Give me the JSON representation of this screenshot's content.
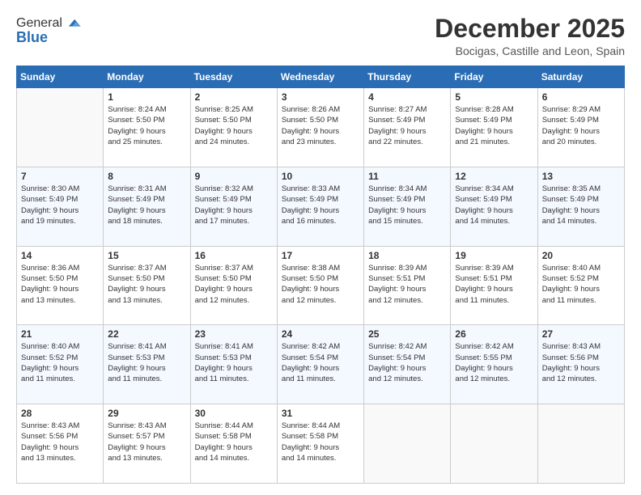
{
  "header": {
    "logo_line1": "General",
    "logo_line2": "Blue",
    "month_title": "December 2025",
    "location": "Bocigas, Castille and Leon, Spain"
  },
  "days_of_week": [
    "Sunday",
    "Monday",
    "Tuesday",
    "Wednesday",
    "Thursday",
    "Friday",
    "Saturday"
  ],
  "weeks": [
    [
      {
        "day": "",
        "info": ""
      },
      {
        "day": "1",
        "info": "Sunrise: 8:24 AM\nSunset: 5:50 PM\nDaylight: 9 hours\nand 25 minutes."
      },
      {
        "day": "2",
        "info": "Sunrise: 8:25 AM\nSunset: 5:50 PM\nDaylight: 9 hours\nand 24 minutes."
      },
      {
        "day": "3",
        "info": "Sunrise: 8:26 AM\nSunset: 5:50 PM\nDaylight: 9 hours\nand 23 minutes."
      },
      {
        "day": "4",
        "info": "Sunrise: 8:27 AM\nSunset: 5:49 PM\nDaylight: 9 hours\nand 22 minutes."
      },
      {
        "day": "5",
        "info": "Sunrise: 8:28 AM\nSunset: 5:49 PM\nDaylight: 9 hours\nand 21 minutes."
      },
      {
        "day": "6",
        "info": "Sunrise: 8:29 AM\nSunset: 5:49 PM\nDaylight: 9 hours\nand 20 minutes."
      }
    ],
    [
      {
        "day": "7",
        "info": "Sunrise: 8:30 AM\nSunset: 5:49 PM\nDaylight: 9 hours\nand 19 minutes."
      },
      {
        "day": "8",
        "info": "Sunrise: 8:31 AM\nSunset: 5:49 PM\nDaylight: 9 hours\nand 18 minutes."
      },
      {
        "day": "9",
        "info": "Sunrise: 8:32 AM\nSunset: 5:49 PM\nDaylight: 9 hours\nand 17 minutes."
      },
      {
        "day": "10",
        "info": "Sunrise: 8:33 AM\nSunset: 5:49 PM\nDaylight: 9 hours\nand 16 minutes."
      },
      {
        "day": "11",
        "info": "Sunrise: 8:34 AM\nSunset: 5:49 PM\nDaylight: 9 hours\nand 15 minutes."
      },
      {
        "day": "12",
        "info": "Sunrise: 8:34 AM\nSunset: 5:49 PM\nDaylight: 9 hours\nand 14 minutes."
      },
      {
        "day": "13",
        "info": "Sunrise: 8:35 AM\nSunset: 5:49 PM\nDaylight: 9 hours\nand 14 minutes."
      }
    ],
    [
      {
        "day": "14",
        "info": "Sunrise: 8:36 AM\nSunset: 5:50 PM\nDaylight: 9 hours\nand 13 minutes."
      },
      {
        "day": "15",
        "info": "Sunrise: 8:37 AM\nSunset: 5:50 PM\nDaylight: 9 hours\nand 13 minutes."
      },
      {
        "day": "16",
        "info": "Sunrise: 8:37 AM\nSunset: 5:50 PM\nDaylight: 9 hours\nand 12 minutes."
      },
      {
        "day": "17",
        "info": "Sunrise: 8:38 AM\nSunset: 5:50 PM\nDaylight: 9 hours\nand 12 minutes."
      },
      {
        "day": "18",
        "info": "Sunrise: 8:39 AM\nSunset: 5:51 PM\nDaylight: 9 hours\nand 12 minutes."
      },
      {
        "day": "19",
        "info": "Sunrise: 8:39 AM\nSunset: 5:51 PM\nDaylight: 9 hours\nand 11 minutes."
      },
      {
        "day": "20",
        "info": "Sunrise: 8:40 AM\nSunset: 5:52 PM\nDaylight: 9 hours\nand 11 minutes."
      }
    ],
    [
      {
        "day": "21",
        "info": "Sunrise: 8:40 AM\nSunset: 5:52 PM\nDaylight: 9 hours\nand 11 minutes."
      },
      {
        "day": "22",
        "info": "Sunrise: 8:41 AM\nSunset: 5:53 PM\nDaylight: 9 hours\nand 11 minutes."
      },
      {
        "day": "23",
        "info": "Sunrise: 8:41 AM\nSunset: 5:53 PM\nDaylight: 9 hours\nand 11 minutes."
      },
      {
        "day": "24",
        "info": "Sunrise: 8:42 AM\nSunset: 5:54 PM\nDaylight: 9 hours\nand 11 minutes."
      },
      {
        "day": "25",
        "info": "Sunrise: 8:42 AM\nSunset: 5:54 PM\nDaylight: 9 hours\nand 12 minutes."
      },
      {
        "day": "26",
        "info": "Sunrise: 8:42 AM\nSunset: 5:55 PM\nDaylight: 9 hours\nand 12 minutes."
      },
      {
        "day": "27",
        "info": "Sunrise: 8:43 AM\nSunset: 5:56 PM\nDaylight: 9 hours\nand 12 minutes."
      }
    ],
    [
      {
        "day": "28",
        "info": "Sunrise: 8:43 AM\nSunset: 5:56 PM\nDaylight: 9 hours\nand 13 minutes."
      },
      {
        "day": "29",
        "info": "Sunrise: 8:43 AM\nSunset: 5:57 PM\nDaylight: 9 hours\nand 13 minutes."
      },
      {
        "day": "30",
        "info": "Sunrise: 8:44 AM\nSunset: 5:58 PM\nDaylight: 9 hours\nand 14 minutes."
      },
      {
        "day": "31",
        "info": "Sunrise: 8:44 AM\nSunset: 5:58 PM\nDaylight: 9 hours\nand 14 minutes."
      },
      {
        "day": "",
        "info": ""
      },
      {
        "day": "",
        "info": ""
      },
      {
        "day": "",
        "info": ""
      }
    ]
  ]
}
